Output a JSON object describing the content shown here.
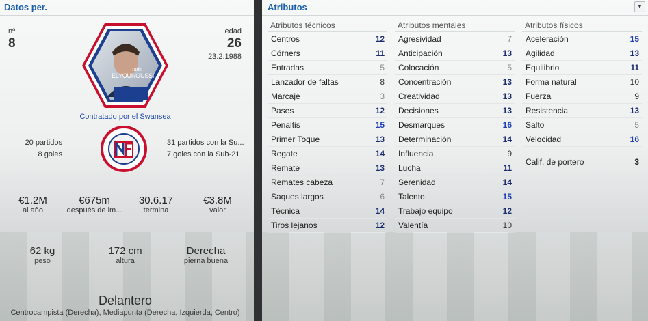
{
  "personal": {
    "title": "Datos per.",
    "number_label": "nº",
    "number": "8",
    "age_label": "edad",
    "age": "26",
    "birthdate": "23.2.1988",
    "card_name_small": "Tarik",
    "card_name": "ELYOUNOUSSI",
    "contract": "Contratado por el Swansea",
    "left_stats": [
      "20 partidos",
      "8 goles"
    ],
    "right_stats": [
      "31 partidos con la Su...",
      "7 goles con la Sub-21"
    ],
    "finance": [
      {
        "value": "€1.2M",
        "label": "al año"
      },
      {
        "value": "€675m",
        "label": "después de im..."
      },
      {
        "value": "30.6.17",
        "label": "termina"
      },
      {
        "value": "€3.8M",
        "label": "valor"
      }
    ],
    "physical": [
      {
        "value": "62 kg",
        "label": "peso"
      },
      {
        "value": "172 cm",
        "label": "altura"
      },
      {
        "value": "Derecha",
        "label": "pierna buena"
      }
    ],
    "position": "Delantero",
    "positions_detail": "Centrocampista (Derecha), Mediapunta (Derecha, Izquierda, Centro)"
  },
  "attributes": {
    "title": "Atributos",
    "technical": {
      "heading": "Atributos técnicos",
      "items": [
        {
          "name": "Centros",
          "value": "12"
        },
        {
          "name": "Córners",
          "value": "11"
        },
        {
          "name": "Entradas",
          "value": "5"
        },
        {
          "name": "Lanzador de faltas",
          "value": "8"
        },
        {
          "name": "Marcaje",
          "value": "3"
        },
        {
          "name": "Pases",
          "value": "12"
        },
        {
          "name": "Penaltis",
          "value": "15"
        },
        {
          "name": "Primer Toque",
          "value": "13"
        },
        {
          "name": "Regate",
          "value": "14"
        },
        {
          "name": "Remate",
          "value": "13"
        },
        {
          "name": "Remates cabeza",
          "value": "7"
        },
        {
          "name": "Saques largos",
          "value": "6"
        },
        {
          "name": "Técnica",
          "value": "14"
        },
        {
          "name": "Tiros lejanos",
          "value": "12"
        }
      ]
    },
    "mental": {
      "heading": "Atributos mentales",
      "items": [
        {
          "name": "Agresividad",
          "value": "7"
        },
        {
          "name": "Anticipación",
          "value": "13"
        },
        {
          "name": "Colocación",
          "value": "5"
        },
        {
          "name": "Concentración",
          "value": "13"
        },
        {
          "name": "Creatividad",
          "value": "13"
        },
        {
          "name": "Decisiones",
          "value": "13"
        },
        {
          "name": "Desmarques",
          "value": "16"
        },
        {
          "name": "Determinación",
          "value": "14"
        },
        {
          "name": "Influencia",
          "value": "9"
        },
        {
          "name": "Lucha",
          "value": "11"
        },
        {
          "name": "Serenidad",
          "value": "14"
        },
        {
          "name": "Talento",
          "value": "15"
        },
        {
          "name": "Trabajo equipo",
          "value": "12"
        },
        {
          "name": "Valentía",
          "value": "10"
        }
      ]
    },
    "physical": {
      "heading": "Atributos físicos",
      "items": [
        {
          "name": "Aceleración",
          "value": "15"
        },
        {
          "name": "Agilidad",
          "value": "13"
        },
        {
          "name": "Equilibrio",
          "value": "11"
        },
        {
          "name": "Forma natural",
          "value": "10"
        },
        {
          "name": "Fuerza",
          "value": "9"
        },
        {
          "name": "Resistencia",
          "value": "13"
        },
        {
          "name": "Salto",
          "value": "5"
        },
        {
          "name": "Velocidad",
          "value": "16"
        }
      ],
      "goalkeeper": {
        "name": "Calif. de portero",
        "value": "3"
      }
    }
  },
  "colors": {
    "accent": "#1b5fa8",
    "value_high": "#1f3fb4",
    "value_mid": "#1b2c6f",
    "value_low": "#888888"
  }
}
